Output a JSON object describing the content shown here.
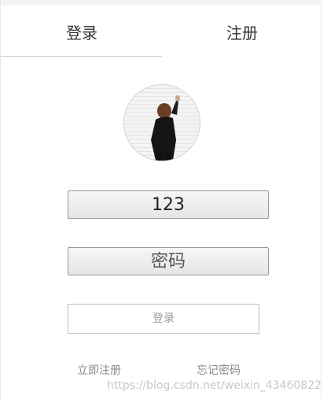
{
  "tabs": {
    "login_label": "登录",
    "register_label": "注册"
  },
  "form": {
    "username_value": "123",
    "password_placeholder": "密码",
    "login_button_label": "登录"
  },
  "links": {
    "register_now": "立即注册",
    "forgot_password": "忘记密码"
  },
  "watermark": "https://blog.csdn.net/weixin_43460822",
  "colors": {
    "input_border": "#999999",
    "button_text": "#9a9a9a",
    "link_text": "#8a8a8a"
  }
}
